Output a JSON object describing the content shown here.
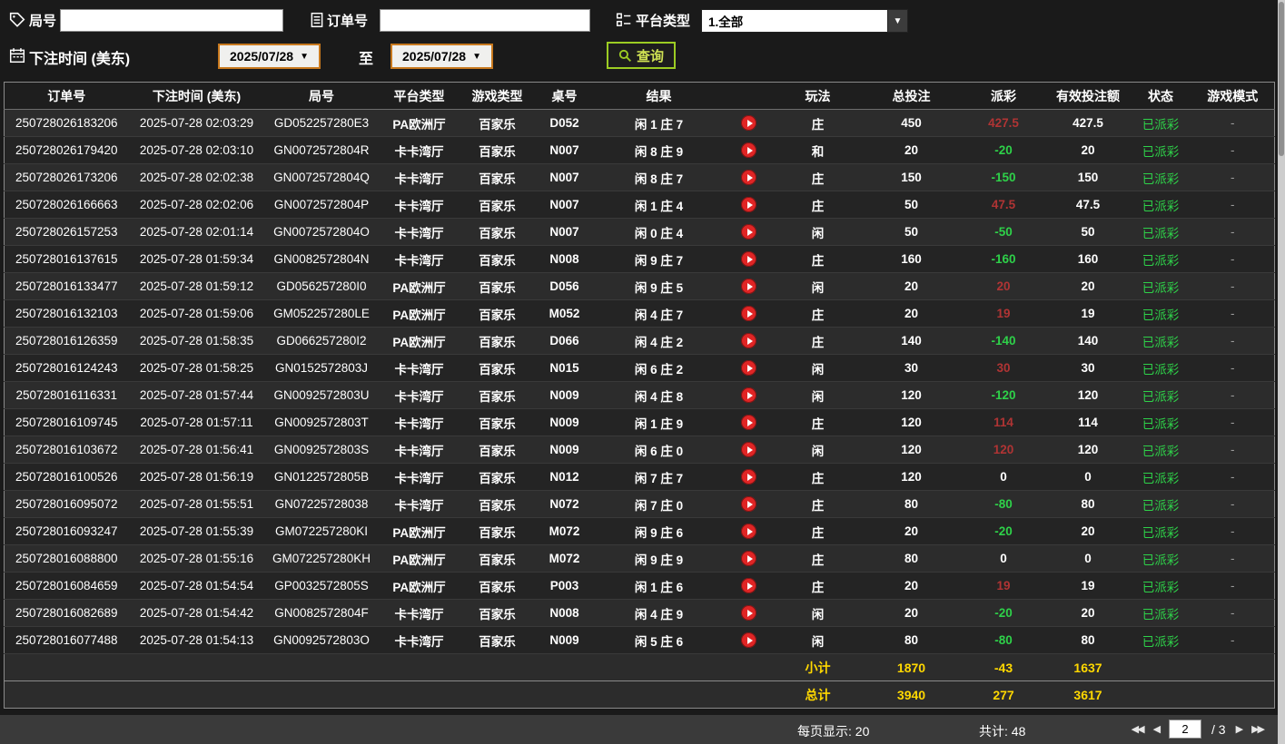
{
  "filters": {
    "round": {
      "label": "局号",
      "value": ""
    },
    "order": {
      "label": "订单号",
      "value": ""
    },
    "platform": {
      "label": "平台类型",
      "value": "1.全部"
    },
    "bet_time": {
      "label": "下注时间 (美东)",
      "from": "2025/07/28",
      "to_label": "至",
      "to": "2025/07/28"
    },
    "query_label": "查询"
  },
  "table": {
    "headers": [
      "订单号",
      "下注时间 (美东)",
      "局号",
      "平台类型",
      "游戏类型",
      "桌号",
      "结果",
      "",
      "玩法",
      "总投注",
      "派彩",
      "有效投注额",
      "状态",
      "游戏模式"
    ],
    "rows": [
      {
        "order_id": "250728026183206",
        "bet_time": "2025-07-28 02:03:29",
        "round_id": "GD052257280E3",
        "platform": "PA欧洲厅",
        "game_type": "百家乐",
        "table_no": "D052",
        "result": "闲 1 庄 7",
        "play": "庄",
        "total_bet": "450",
        "payout": "427.5",
        "valid_bet": "427.5",
        "status": "已派彩",
        "mode": "-"
      },
      {
        "order_id": "250728026179420",
        "bet_time": "2025-07-28 02:03:10",
        "round_id": "GN0072572804R",
        "platform": "卡卡湾厅",
        "game_type": "百家乐",
        "table_no": "N007",
        "result": "闲 8 庄 9",
        "play": "和",
        "total_bet": "20",
        "payout": "-20",
        "valid_bet": "20",
        "status": "已派彩",
        "mode": "-"
      },
      {
        "order_id": "250728026173206",
        "bet_time": "2025-07-28 02:02:38",
        "round_id": "GN0072572804Q",
        "platform": "卡卡湾厅",
        "game_type": "百家乐",
        "table_no": "N007",
        "result": "闲 8 庄 7",
        "play": "庄",
        "total_bet": "150",
        "payout": "-150",
        "valid_bet": "150",
        "status": "已派彩",
        "mode": "-"
      },
      {
        "order_id": "250728026166663",
        "bet_time": "2025-07-28 02:02:06",
        "round_id": "GN0072572804P",
        "platform": "卡卡湾厅",
        "game_type": "百家乐",
        "table_no": "N007",
        "result": "闲 1 庄 4",
        "play": "庄",
        "total_bet": "50",
        "payout": "47.5",
        "valid_bet": "47.5",
        "status": "已派彩",
        "mode": "-"
      },
      {
        "order_id": "250728026157253",
        "bet_time": "2025-07-28 02:01:14",
        "round_id": "GN0072572804O",
        "platform": "卡卡湾厅",
        "game_type": "百家乐",
        "table_no": "N007",
        "result": "闲 0 庄 4",
        "play": "闲",
        "total_bet": "50",
        "payout": "-50",
        "valid_bet": "50",
        "status": "已派彩",
        "mode": "-"
      },
      {
        "order_id": "250728016137615",
        "bet_time": "2025-07-28 01:59:34",
        "round_id": "GN0082572804N",
        "platform": "卡卡湾厅",
        "game_type": "百家乐",
        "table_no": "N008",
        "result": "闲 9 庄 7",
        "play": "庄",
        "total_bet": "160",
        "payout": "-160",
        "valid_bet": "160",
        "status": "已派彩",
        "mode": "-"
      },
      {
        "order_id": "250728016133477",
        "bet_time": "2025-07-28 01:59:12",
        "round_id": "GD056257280I0",
        "platform": "PA欧洲厅",
        "game_type": "百家乐",
        "table_no": "D056",
        "result": "闲 9 庄 5",
        "play": "闲",
        "total_bet": "20",
        "payout": "20",
        "valid_bet": "20",
        "status": "已派彩",
        "mode": "-"
      },
      {
        "order_id": "250728016132103",
        "bet_time": "2025-07-28 01:59:06",
        "round_id": "GM052257280LE",
        "platform": "PA欧洲厅",
        "game_type": "百家乐",
        "table_no": "M052",
        "result": "闲 4 庄 7",
        "play": "庄",
        "total_bet": "20",
        "payout": "19",
        "valid_bet": "19",
        "status": "已派彩",
        "mode": "-"
      },
      {
        "order_id": "250728016126359",
        "bet_time": "2025-07-28 01:58:35",
        "round_id": "GD066257280I2",
        "platform": "PA欧洲厅",
        "game_type": "百家乐",
        "table_no": "D066",
        "result": "闲 4 庄 2",
        "play": "庄",
        "total_bet": "140",
        "payout": "-140",
        "valid_bet": "140",
        "status": "已派彩",
        "mode": "-"
      },
      {
        "order_id": "250728016124243",
        "bet_time": "2025-07-28 01:58:25",
        "round_id": "GN0152572803J",
        "platform": "卡卡湾厅",
        "game_type": "百家乐",
        "table_no": "N015",
        "result": "闲 6 庄 2",
        "play": "闲",
        "total_bet": "30",
        "payout": "30",
        "valid_bet": "30",
        "status": "已派彩",
        "mode": "-"
      },
      {
        "order_id": "250728016116331",
        "bet_time": "2025-07-28 01:57:44",
        "round_id": "GN0092572803U",
        "platform": "卡卡湾厅",
        "game_type": "百家乐",
        "table_no": "N009",
        "result": "闲 4 庄 8",
        "play": "闲",
        "total_bet": "120",
        "payout": "-120",
        "valid_bet": "120",
        "status": "已派彩",
        "mode": "-"
      },
      {
        "order_id": "250728016109745",
        "bet_time": "2025-07-28 01:57:11",
        "round_id": "GN0092572803T",
        "platform": "卡卡湾厅",
        "game_type": "百家乐",
        "table_no": "N009",
        "result": "闲 1 庄 9",
        "play": "庄",
        "total_bet": "120",
        "payout": "114",
        "valid_bet": "114",
        "status": "已派彩",
        "mode": "-"
      },
      {
        "order_id": "250728016103672",
        "bet_time": "2025-07-28 01:56:41",
        "round_id": "GN0092572803S",
        "platform": "卡卡湾厅",
        "game_type": "百家乐",
        "table_no": "N009",
        "result": "闲 6 庄 0",
        "play": "闲",
        "total_bet": "120",
        "payout": "120",
        "valid_bet": "120",
        "status": "已派彩",
        "mode": "-"
      },
      {
        "order_id": "250728016100526",
        "bet_time": "2025-07-28 01:56:19",
        "round_id": "GN0122572805B",
        "platform": "卡卡湾厅",
        "game_type": "百家乐",
        "table_no": "N012",
        "result": "闲 7 庄 7",
        "play": "庄",
        "total_bet": "120",
        "payout": "0",
        "valid_bet": "0",
        "status": "已派彩",
        "mode": "-"
      },
      {
        "order_id": "250728016095072",
        "bet_time": "2025-07-28 01:55:51",
        "round_id": "GN07225728038",
        "platform": "卡卡湾厅",
        "game_type": "百家乐",
        "table_no": "N072",
        "result": "闲 7 庄 0",
        "play": "庄",
        "total_bet": "80",
        "payout": "-80",
        "valid_bet": "80",
        "status": "已派彩",
        "mode": "-"
      },
      {
        "order_id": "250728016093247",
        "bet_time": "2025-07-28 01:55:39",
        "round_id": "GM072257280KI",
        "platform": "PA欧洲厅",
        "game_type": "百家乐",
        "table_no": "M072",
        "result": "闲 9 庄 6",
        "play": "庄",
        "total_bet": "20",
        "payout": "-20",
        "valid_bet": "20",
        "status": "已派彩",
        "mode": "-"
      },
      {
        "order_id": "250728016088800",
        "bet_time": "2025-07-28 01:55:16",
        "round_id": "GM072257280KH",
        "platform": "PA欧洲厅",
        "game_type": "百家乐",
        "table_no": "M072",
        "result": "闲 9 庄 9",
        "play": "庄",
        "total_bet": "80",
        "payout": "0",
        "valid_bet": "0",
        "status": "已派彩",
        "mode": "-"
      },
      {
        "order_id": "250728016084659",
        "bet_time": "2025-07-28 01:54:54",
        "round_id": "GP0032572805S",
        "platform": "PA欧洲厅",
        "game_type": "百家乐",
        "table_no": "P003",
        "result": "闲 1 庄 6",
        "play": "庄",
        "total_bet": "20",
        "payout": "19",
        "valid_bet": "19",
        "status": "已派彩",
        "mode": "-"
      },
      {
        "order_id": "250728016082689",
        "bet_time": "2025-07-28 01:54:42",
        "round_id": "GN0082572804F",
        "platform": "卡卡湾厅",
        "game_type": "百家乐",
        "table_no": "N008",
        "result": "闲 4 庄 9",
        "play": "闲",
        "total_bet": "20",
        "payout": "-20",
        "valid_bet": "20",
        "status": "已派彩",
        "mode": "-"
      },
      {
        "order_id": "250728016077488",
        "bet_time": "2025-07-28 01:54:13",
        "round_id": "GN0092572803O",
        "platform": "卡卡湾厅",
        "game_type": "百家乐",
        "table_no": "N009",
        "result": "闲 5 庄 6",
        "play": "闲",
        "total_bet": "80",
        "payout": "-80",
        "valid_bet": "80",
        "status": "已派彩",
        "mode": "-"
      }
    ],
    "summary": [
      {
        "label": "小计",
        "total_bet": "1870",
        "payout": "-43",
        "valid_bet": "1637"
      },
      {
        "label": "总计",
        "total_bet": "3940",
        "payout": "277",
        "valid_bet": "3617"
      }
    ]
  },
  "pagination": {
    "per_page": "每页显示: 20",
    "total": "共计: 48",
    "page": "2",
    "pages": "/ 3"
  },
  "colors": {
    "payout_win": "#b03434",
    "payout_lose": "#2ed149",
    "status_paid": "#2ed149",
    "summary_yellow": "#ffd800",
    "query_green": "#9ccc23"
  }
}
